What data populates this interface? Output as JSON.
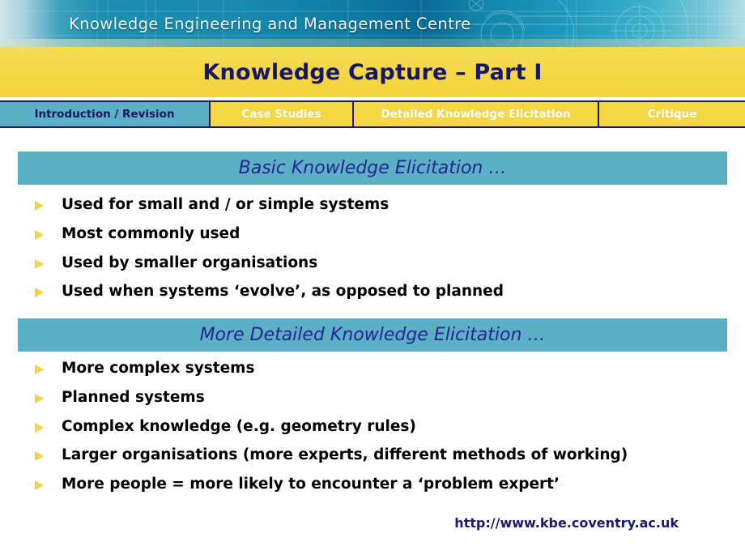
{
  "banner": {
    "org_title": "Knowledge Engineering and Management Centre",
    "accent_dark": "#0a6b96",
    "accent_light": "#b9dee8"
  },
  "title_bar": {
    "title": "Knowledge Capture – Part I",
    "background": "#f5d846",
    "text_color": "#16166b"
  },
  "tabs": {
    "items": [
      {
        "label": "Introduction / Revision",
        "state": "active"
      },
      {
        "label": "Case Studies",
        "state": "inactive"
      },
      {
        "label": "Detailed Knowledge Elicitation",
        "state": "inactive"
      },
      {
        "label": "Critique",
        "state": "inactive"
      }
    ],
    "active_bg": "#5bb0c6",
    "active_text": "#17175f",
    "inactive_bg": "#f5d645",
    "inactive_text": "#ffffff"
  },
  "sections": [
    {
      "heading": "Basic Knowledge Elicitation …",
      "bullets": [
        "Used for small and / or simple systems",
        "Most commonly used",
        "Used by smaller organisations",
        "Used when systems ‘evolve’, as opposed to planned"
      ]
    },
    {
      "heading": "More Detailed Knowledge Elicitation …",
      "bullets": [
        "More complex systems",
        "Planned systems",
        "Complex knowledge (e.g. geometry rules)",
        "Larger organisations (more experts, different methods of working)",
        "More people = more likely to encounter a ‘problem expert’"
      ]
    }
  ],
  "section_style": {
    "bar_color": "#5bb0c6",
    "heading_color": "#252590",
    "bullet_marker_color": "#f3d34a",
    "bullet_text_color": "#000000"
  },
  "footer": {
    "url": "http://www.kbe.coventry.ac.uk",
    "color": "#1a1a6e"
  }
}
